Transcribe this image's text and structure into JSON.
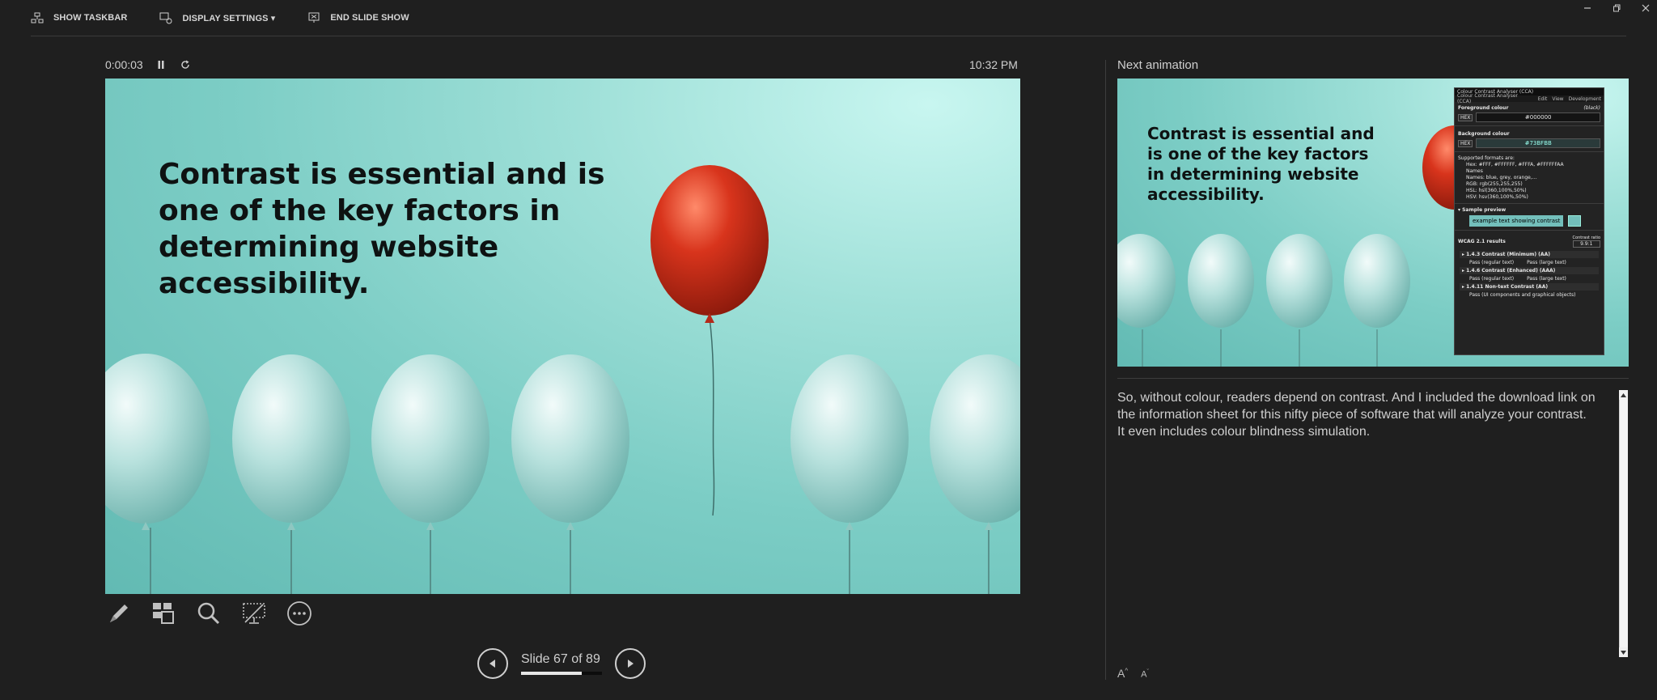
{
  "window": {
    "controls": [
      "minimize-icon",
      "restore-icon",
      "close-icon"
    ]
  },
  "toolbar": {
    "show_taskbar": "SHOW TASKBAR",
    "display_settings": "DISPLAY SETTINGS ▾",
    "end_slide_show": "END SLIDE SHOW"
  },
  "presenter": {
    "elapsed": "0:00:03",
    "clock": "10:32 PM"
  },
  "current_slide": {
    "title": "Contrast is essential and is one of the key factors in determining website accessibility."
  },
  "navigation": {
    "slide_text": "Slide 67 of 89",
    "current": 67,
    "total": 89,
    "progress_fraction": 0.75
  },
  "next_panel": {
    "label": "Next animation",
    "thumb_title": "Contrast is essential and is one of the key factors in determining website accessibility.",
    "cca": {
      "title": "Colour Contrast Analyser (CCA)",
      "menu": [
        "Colour Contrast Analyser (CCA)",
        "Edit",
        "View",
        "Development"
      ],
      "foreground_label": "Foreground colour",
      "foreground_name": "(black)",
      "fg_format": "HEX",
      "fg_value": "#000000",
      "background_label": "Background colour",
      "bg_format": "HEX",
      "bg_value": "#73BFBB",
      "supported_label": "Supported formats are:",
      "formats": [
        "Hex: #FFF, #FFFFFF, #FFFA, #FFFFFFAA",
        "Names",
        "Names: blue, grey, orange,…",
        "RGB: rgb(255,255,255)",
        "HSL: hsl(360,100%,50%)",
        "HSV: hsv(360,100%,50%)"
      ],
      "sample_label": "▾ Sample preview",
      "sample_text": "example text showing contrast",
      "results_label": "WCAG 2.1 results",
      "contrast_ratio_label": "Contrast ratio",
      "contrast_ratio": "9.9:1",
      "criteria": [
        {
          "name": "▸ 1.4.3 Contrast (Minimum) (AA)",
          "results": [
            "Pass (regular text)",
            "Pass (large text)"
          ]
        },
        {
          "name": "▸ 1.4.6 Contrast (Enhanced) (AAA)",
          "results": [
            "Pass (regular text)",
            "Pass (large text)"
          ]
        },
        {
          "name": "▸ 1.4.11 Non-text Contrast (AA)",
          "results": [
            "Pass (UI components and graphical objects)"
          ]
        }
      ]
    }
  },
  "notes": {
    "lines": [
      "So, without colour, readers depend on contrast. And I included the download link on the information sheet for this nifty piece of software that will analyze your contrast.",
      "It even includes colour blindness simulation."
    ]
  },
  "font_controls": {
    "increase": "A",
    "decrease": "A"
  }
}
